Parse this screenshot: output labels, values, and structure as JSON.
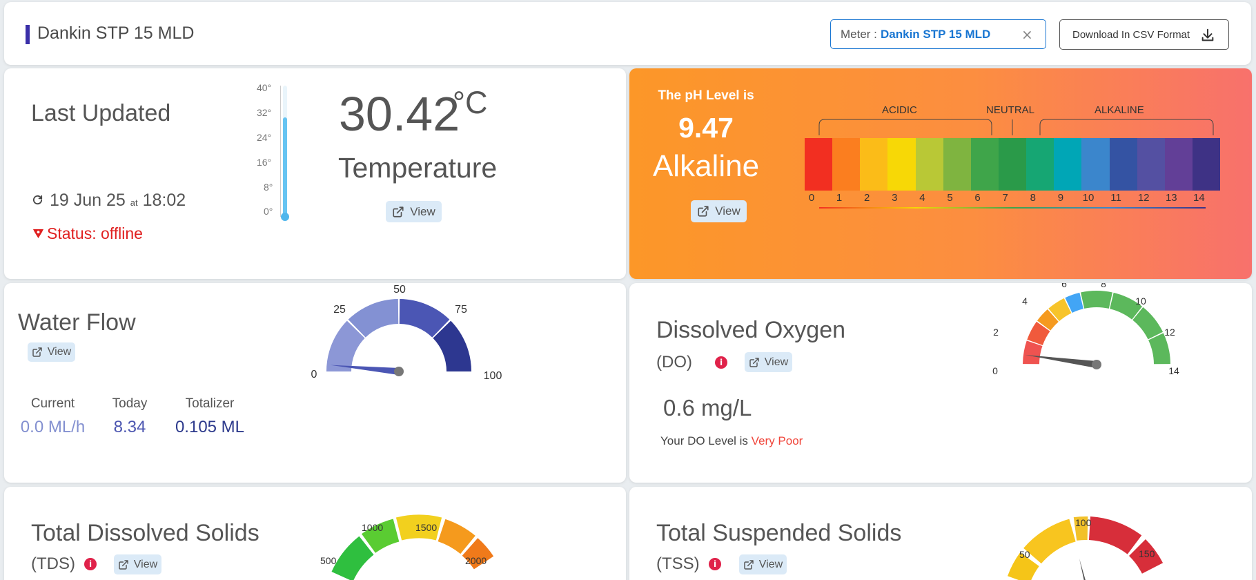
{
  "header": {
    "title": "Dankin STP 15 MLD",
    "meter_label": "Meter :",
    "meter_value": "Dankin STP 15 MLD",
    "download_label": "Download In CSV Format"
  },
  "temperature": {
    "title": "Last Updated",
    "date": "19 Jun 25",
    "at": "at",
    "time": "18:02",
    "status": "Status: offline",
    "value": "30.42",
    "unit": "°C",
    "label": "Temperature",
    "view": "View",
    "thermo_ticks": [
      "40°",
      "32°",
      "24°",
      "16°",
      "8°",
      "0°"
    ],
    "thermo_level": 0.76
  },
  "ph": {
    "intro": "The pH Level is",
    "value": "9.47",
    "category": "Alkaline",
    "view": "View",
    "acidic": "ACIDIC",
    "neutral": "NEUTRAL",
    "alkaline": "ALKALINE",
    "scale": [
      "0",
      "1",
      "2",
      "3",
      "4",
      "5",
      "6",
      "7",
      "8",
      "9",
      "10",
      "11",
      "12",
      "13",
      "14"
    ],
    "colors": [
      "#f22f21",
      "#fb7e1f",
      "#fbbc18",
      "#f7d806",
      "#b9c836",
      "#7fb440",
      "#3fa54a",
      "#2a9a49",
      "#16a673",
      "#00a6b6",
      "#3b86cc",
      "#3453a3",
      "#5450a2",
      "#623f97",
      "#3e3285"
    ]
  },
  "water_flow": {
    "title": "Water Flow",
    "view": "View",
    "stats": [
      {
        "label": "Current",
        "value": "0.0 ML/h",
        "color": "#8390d0"
      },
      {
        "label": "Today",
        "value": "8.34",
        "color": "#4b55b0"
      },
      {
        "label": "Totalizer",
        "value": "0.105 ML",
        "color": "#2d3a8c"
      }
    ],
    "gauge": {
      "ticks": [
        "0",
        "25",
        "50",
        "75",
        "100"
      ],
      "needle_value": 3,
      "max": 100,
      "colors": [
        "#8c97d6",
        "#8391d3",
        "#4b56b4",
        "#2d3790"
      ]
    }
  },
  "dissolved_oxygen": {
    "title": "Dissolved Oxygen",
    "abbr": "(DO)",
    "view": "View",
    "reading": "0.6 mg/L",
    "level_prefix": "Your DO Level is",
    "level": "Very Poor",
    "level_color": "#f0453a",
    "gauge": {
      "ticks": [
        "0",
        "2",
        "4",
        "6",
        "8",
        "10",
        "12",
        "14"
      ],
      "needle_value": 0.6,
      "max": 14
    }
  },
  "tds": {
    "title": "Total Dissolved Solids",
    "abbr": "(TDS)",
    "view": "View",
    "ticks": [
      "500",
      "1000",
      "1500",
      "2000"
    ]
  },
  "tss": {
    "title": "Total Suspended Solids",
    "abbr": "(TSS)",
    "view": "View",
    "ticks": [
      "50",
      "100",
      "150"
    ]
  }
}
